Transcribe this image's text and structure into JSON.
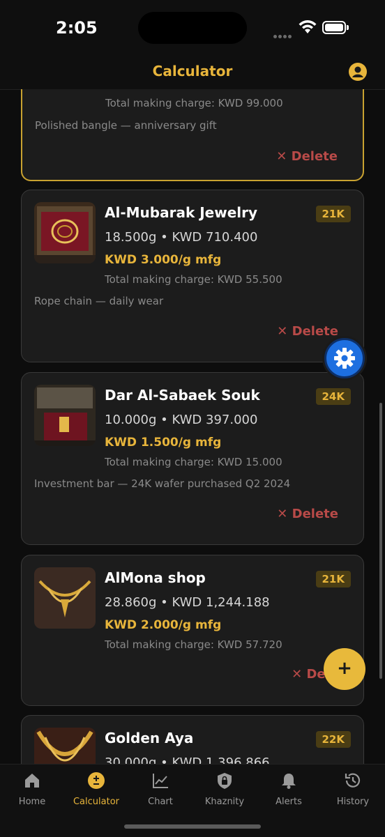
{
  "status": {
    "time": "2:05"
  },
  "header": {
    "title": "Calculator"
  },
  "cards": [
    {
      "shop": "",
      "karat": "",
      "weight": "",
      "rate": "",
      "total": "Total making charge: KWD 99.000",
      "note": "Polished bangle — anniversary gift",
      "delete": "Delete"
    },
    {
      "shop": "Al-Mubarak Jewelry",
      "karat": "21K",
      "weight": "18.500g • KWD 710.400",
      "rate": "KWD 3.000/g mfg",
      "total": "Total making charge: KWD 55.500",
      "note": "Rope chain — daily wear",
      "delete": "Delete"
    },
    {
      "shop": "Dar Al-Sabaek Souk",
      "karat": "24K",
      "weight": "10.000g • KWD 397.000",
      "rate": "KWD 1.500/g mfg",
      "total": "Total making charge: KWD 15.000",
      "note": "Investment bar — 24K wafer purchased Q2 2024",
      "delete": "Delete"
    },
    {
      "shop": "AlMona shop",
      "karat": "21K",
      "weight": "28.860g • KWD 1,244.188",
      "rate": "KWD 2.000/g mfg",
      "total": "Total making charge: KWD 57.720",
      "note": "",
      "delete": "Dele"
    },
    {
      "shop": "Golden Aya",
      "karat": "22K",
      "weight": "30.000g • KWD 1,396.866"
    }
  ],
  "fab": {
    "add_label": "+"
  },
  "tabs": [
    {
      "label": "Home",
      "icon": "home-icon"
    },
    {
      "label": "Calculator",
      "icon": "calculator-icon"
    },
    {
      "label": "Chart",
      "icon": "chart-icon"
    },
    {
      "label": "Khaznity",
      "icon": "vault-icon"
    },
    {
      "label": "Alerts",
      "icon": "bell-icon"
    },
    {
      "label": "History",
      "icon": "history-icon"
    }
  ],
  "colors": {
    "accent": "#e8b53b",
    "danger": "#b84a48",
    "fab_blue": "#1d6fe0"
  }
}
